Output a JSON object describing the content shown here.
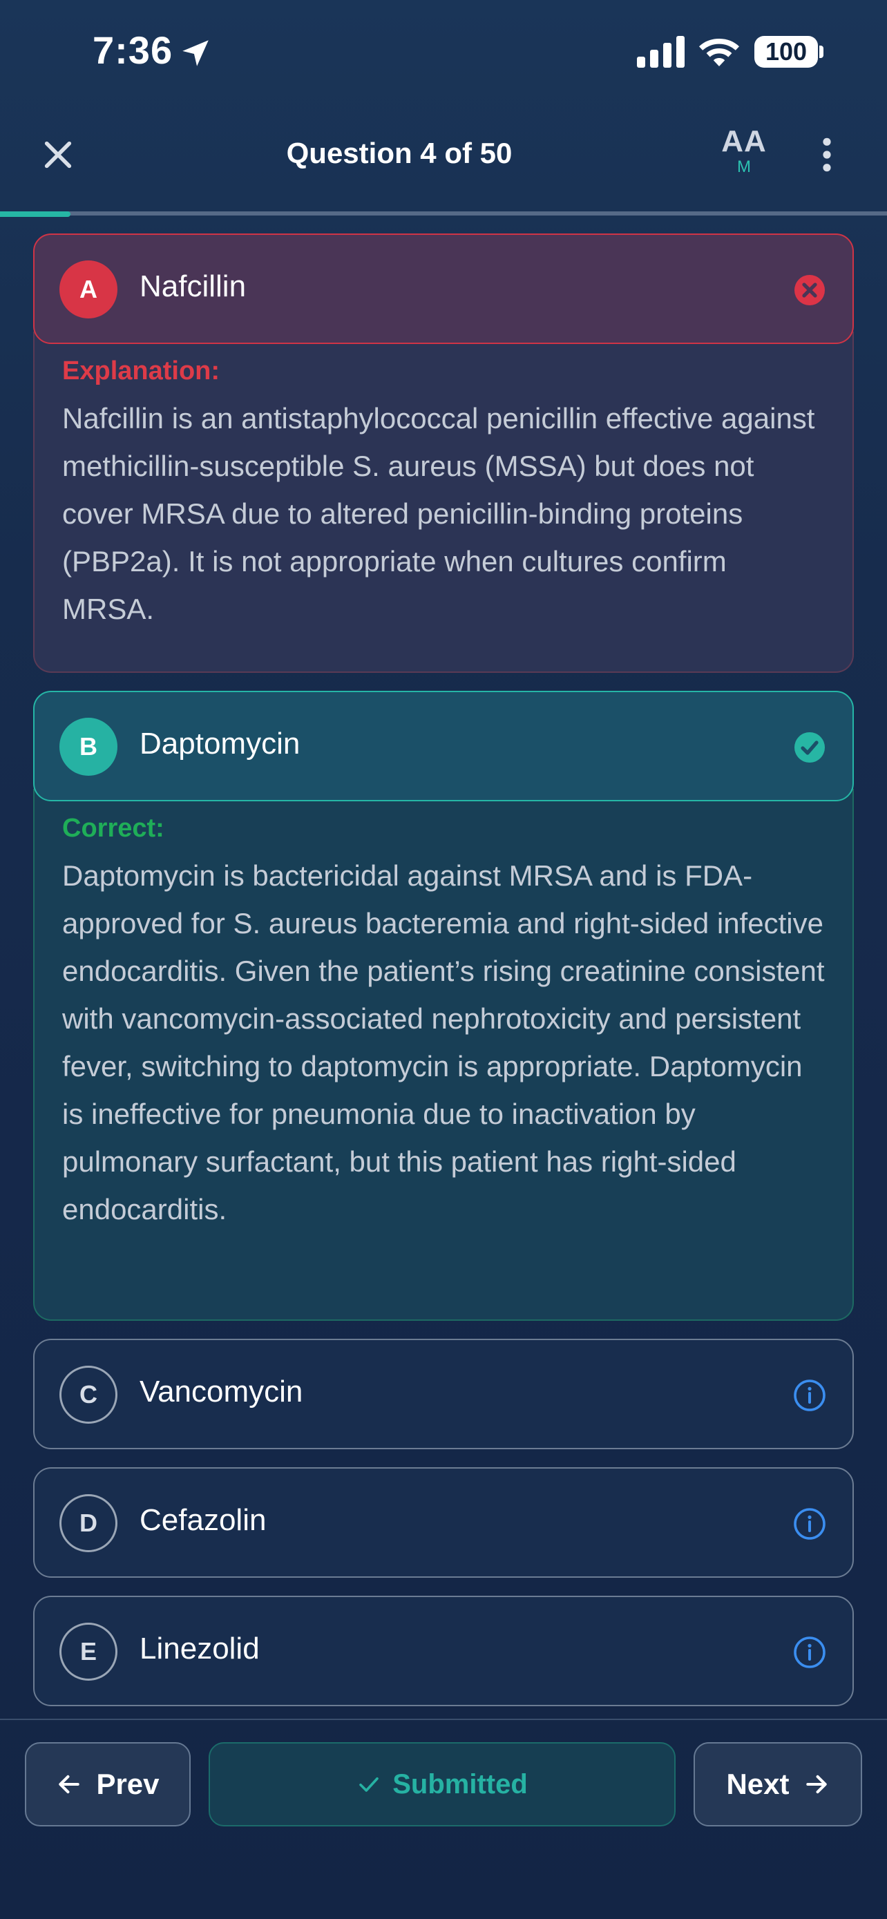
{
  "status_bar": {
    "time": "7:36",
    "battery": "100",
    "icons": [
      "location-arrow-icon",
      "signal-icon",
      "wifi-icon",
      "battery-icon"
    ]
  },
  "header": {
    "title": "Question 4 of 50",
    "font_size_button": {
      "label": "AA",
      "size": "M"
    },
    "icons": [
      "close-icon",
      "more-vertical-icon"
    ],
    "progress_fraction": 0.08
  },
  "options": [
    {
      "letter": "A",
      "label": "Nafcillin",
      "state": "incorrect",
      "status_icon": "x-circle-icon",
      "explanation_heading": "Explanation:",
      "explanation": "Nafcillin is an antistaphylococcal penicillin effective against methicillin-susceptible S. aureus (MSSA) but does not cover MRSA due to altered penicillin-binding proteins (PBP2a). It is not appropriate when cultures confirm MRSA."
    },
    {
      "letter": "B",
      "label": "Daptomycin",
      "state": "correct",
      "status_icon": "check-circle-icon",
      "explanation_heading": "Correct:",
      "explanation": "Daptomycin is bactericidal against MRSA and is FDA-approved for S. aureus bacteremia and right-sided infective endocarditis. Given the patient’s rising creatinine consistent with vancomycin-associated nephrotoxicity and persistent fever, switching to daptomycin is appropriate. Daptomycin is ineffective for pneumonia due to inactivation by pulmonary surfactant, but this patient has right-sided endocarditis."
    },
    {
      "letter": "C",
      "label": "Vancomycin",
      "state": "neutral",
      "status_icon": "info-icon"
    },
    {
      "letter": "D",
      "label": "Cefazolin",
      "state": "neutral",
      "status_icon": "info-icon"
    },
    {
      "letter": "E",
      "label": "Linezolid",
      "state": "neutral",
      "status_icon": "info-icon"
    }
  ],
  "footer": {
    "prev_label": "Prev",
    "submitted_label": "Submitted",
    "next_label": "Next"
  },
  "colors": {
    "background": "#172b4a",
    "accent_teal": "#26b2a3",
    "incorrect_red": "#d83546",
    "correct_green": "#1fae58",
    "info_blue": "#3b8ef0"
  }
}
